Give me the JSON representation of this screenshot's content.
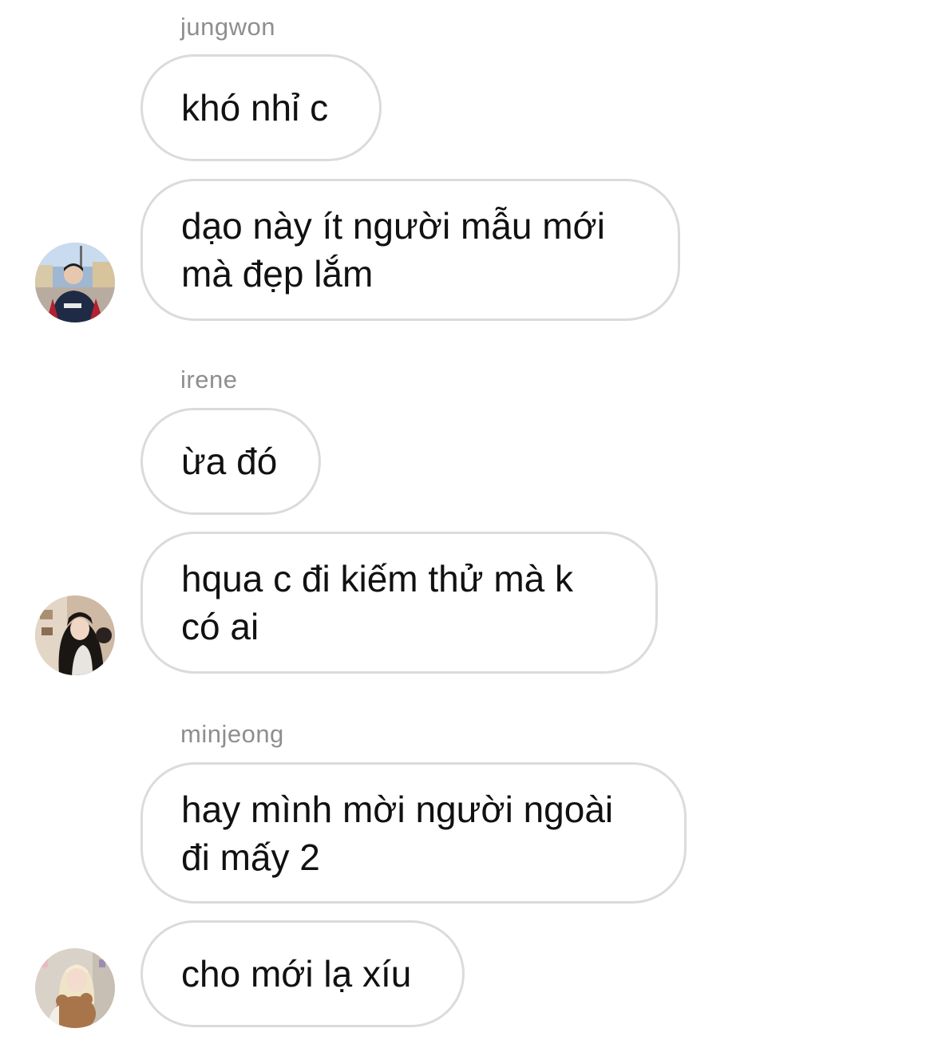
{
  "thread": {
    "groups": [
      {
        "sender": "jungwon",
        "avatar_icon": "profile-photo-avatar",
        "messages": [
          "khó nhỉ c",
          "dạo này ít người mẫu mới\nmà đẹp lắm"
        ]
      },
      {
        "sender": "irene",
        "avatar_icon": "profile-photo-avatar",
        "messages": [
          "ừa đó",
          "hqua c đi kiếm thử mà k\ncó ai"
        ]
      },
      {
        "sender": "minjeong",
        "avatar_icon": "profile-photo-avatar",
        "messages": [
          "hay mình mời người ngoài\nđi mấy 2",
          "cho mới lạ xíu"
        ]
      }
    ]
  },
  "colors": {
    "bubble_border": "#dbdbdb",
    "sender_name": "#8e8e8e",
    "message_text": "#111111",
    "background": "#ffffff"
  }
}
